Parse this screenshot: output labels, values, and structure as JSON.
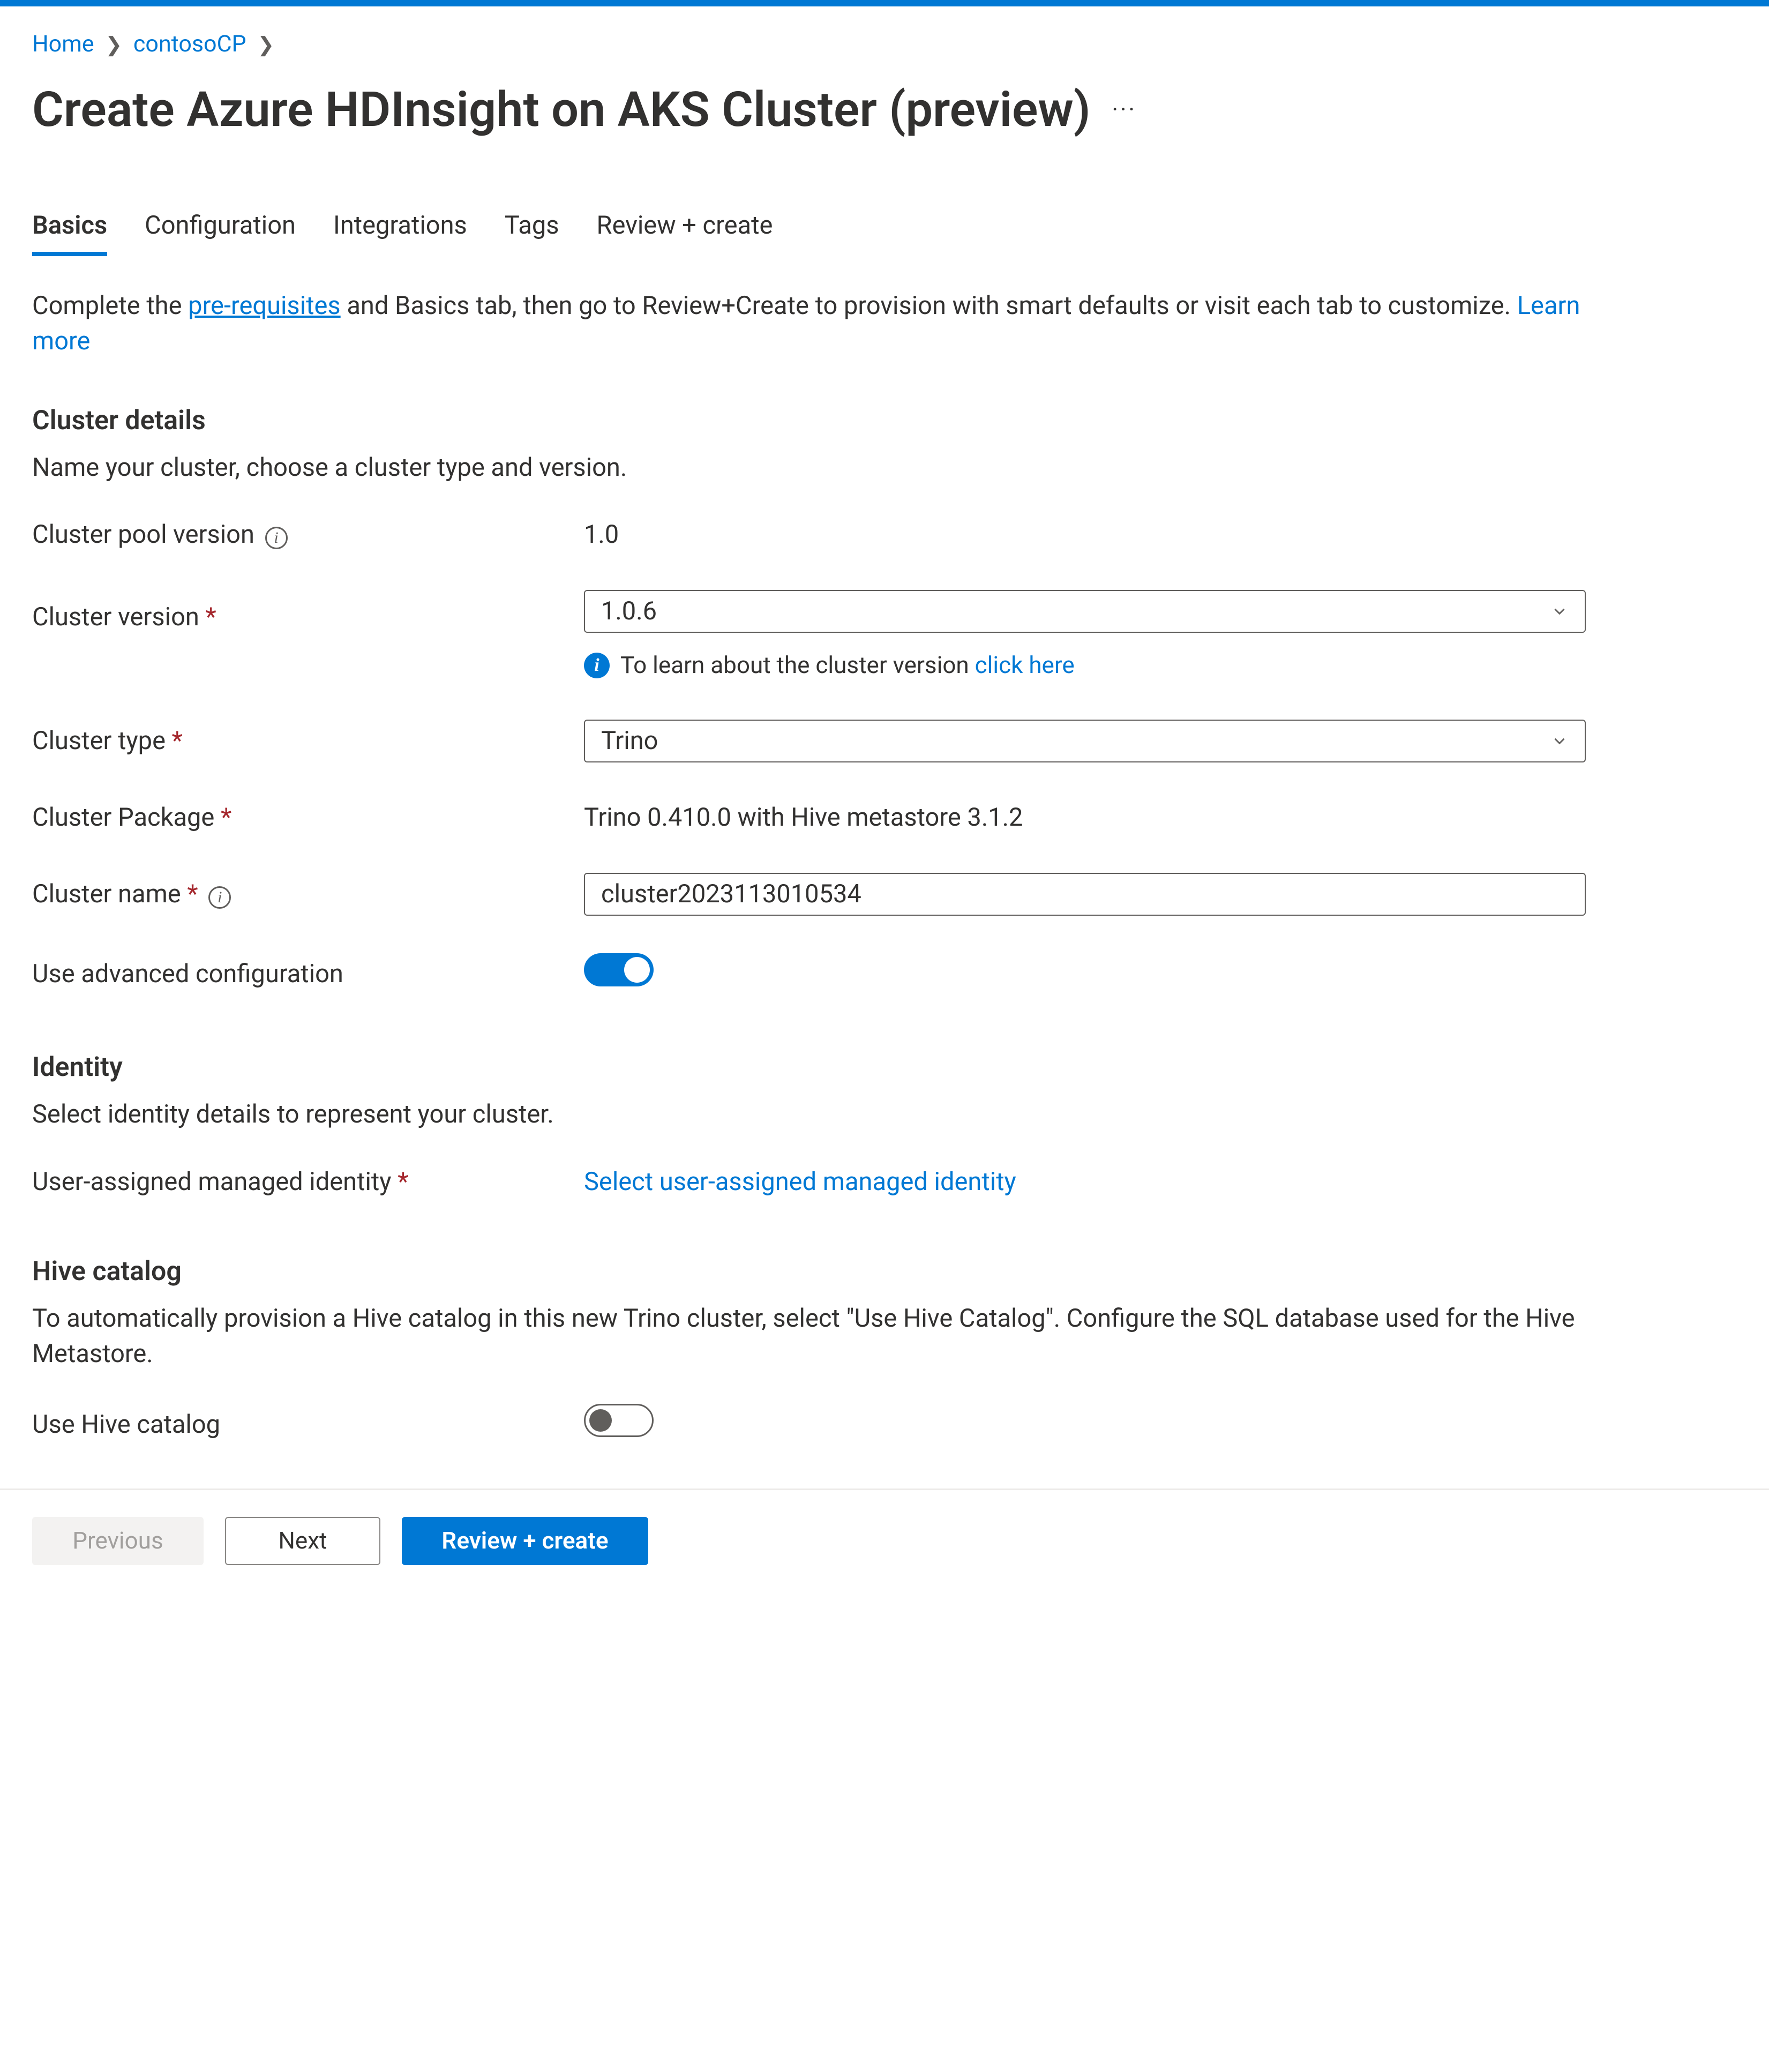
{
  "breadcrumb": {
    "home": "Home",
    "parent": "contosoCP"
  },
  "page_title": "Create Azure HDInsight on AKS Cluster (preview)",
  "tabs": [
    "Basics",
    "Configuration",
    "Integrations",
    "Tags",
    "Review + create"
  ],
  "active_tab_index": 0,
  "intro": {
    "pre": "Complete the ",
    "prereq_link": "pre-requisites",
    "mid": " and Basics tab, then go to Review+Create to provision with smart defaults or visit each tab to customize. ",
    "learn_more": "Learn more"
  },
  "cluster_details": {
    "title": "Cluster details",
    "desc": "Name your cluster, choose a cluster type and version.",
    "pool_version_label": "Cluster pool version",
    "pool_version_value": "1.0",
    "version_label": "Cluster version",
    "version_value": "1.0.6",
    "version_info_pre": "To learn about the cluster version ",
    "version_info_link": "click here",
    "type_label": "Cluster type",
    "type_value": "Trino",
    "package_label": "Cluster Package",
    "package_value": "Trino 0.410.0 with Hive metastore 3.1.2",
    "name_label": "Cluster name",
    "name_value": "cluster2023113010534",
    "advanced_label": "Use advanced configuration"
  },
  "identity": {
    "title": "Identity",
    "desc": "Select identity details to represent your cluster.",
    "uami_label": "User-assigned managed identity",
    "uami_action": "Select user-assigned managed identity"
  },
  "hive": {
    "title": "Hive catalog",
    "desc": "To automatically provision a Hive catalog in this new Trino cluster, select \"Use Hive Catalog\". Configure the SQL database used for the Hive Metastore.",
    "use_label": "Use Hive catalog"
  },
  "footer": {
    "previous": "Previous",
    "next": "Next",
    "review": "Review + create"
  }
}
